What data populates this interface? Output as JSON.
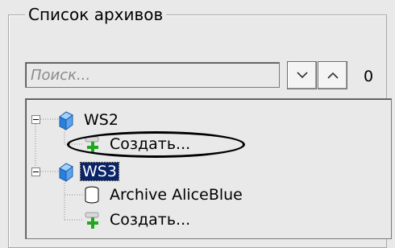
{
  "panel": {
    "title": "Список архивов"
  },
  "search": {
    "placeholder": "Поиск...",
    "count": "0"
  },
  "tree": {
    "nodes": [
      {
        "label": "WS2",
        "icon": "server-icon"
      },
      {
        "label": "Создать...",
        "icon": "add-icon"
      },
      {
        "label": "WS3",
        "icon": "server-icon",
        "selected": true
      },
      {
        "label": "Archive AliceBlue",
        "icon": "database-icon"
      },
      {
        "label": "Создать...",
        "icon": "add-icon"
      }
    ]
  },
  "colors": {
    "background": "#e9e9e9",
    "selection": "#0a246a",
    "add_icon_green": "#1fa81f",
    "server_icon_blue": "#2b7fd9"
  }
}
